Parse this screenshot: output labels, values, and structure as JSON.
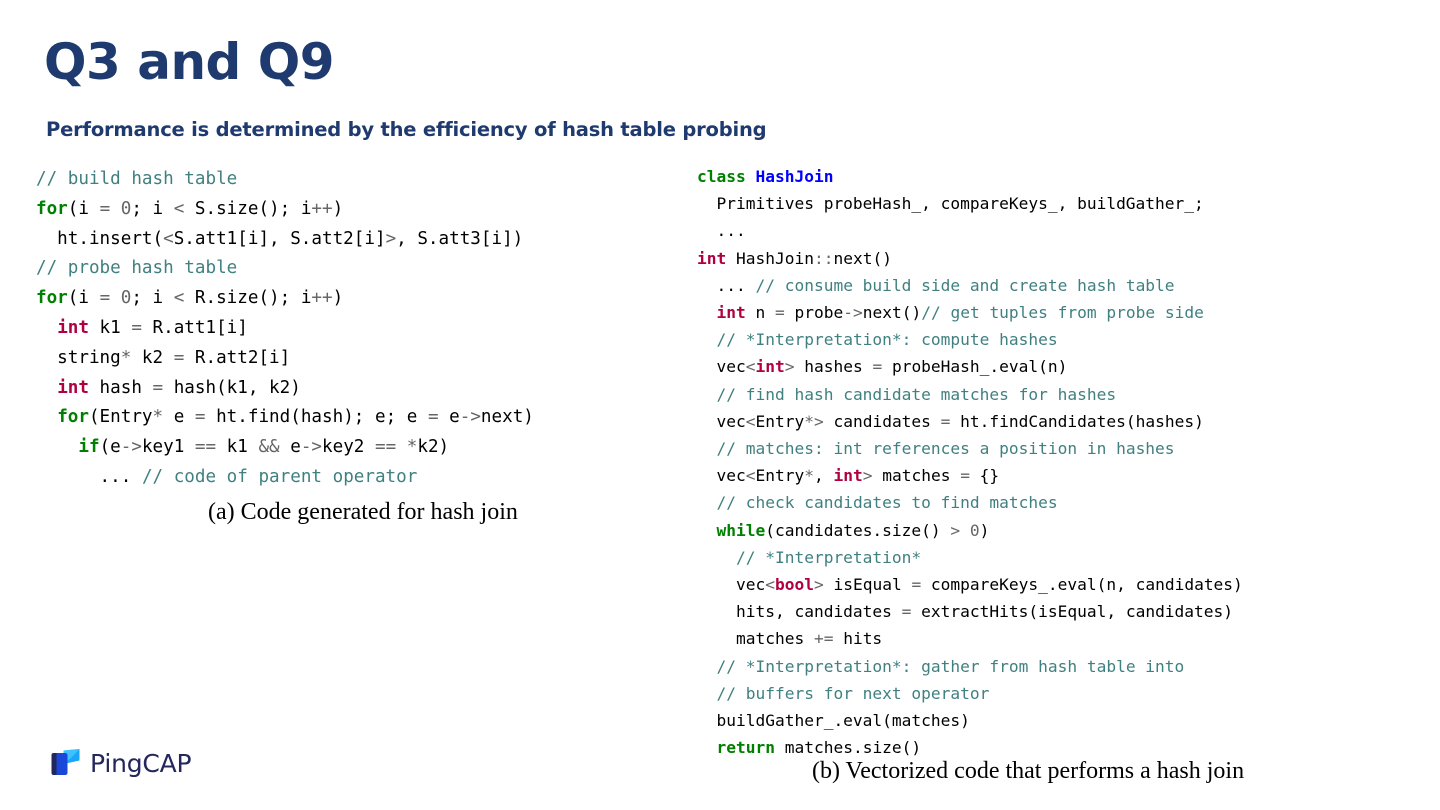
{
  "header": {
    "title": "Q3 and Q9",
    "subtitle": "Performance is determined by the efficiency of hash table probing",
    "title_color": "#1F3A6E"
  },
  "colors": {
    "comment": "#408080",
    "keyword": "#008000",
    "type": "#B00040",
    "class_name": "#0000FF",
    "operator": "#666666",
    "text": "#000000",
    "logo_dark": "#23275B",
    "logo_blue": "#1A9BF0"
  },
  "code_left": {
    "language": "cpp",
    "lines": [
      [
        {
          "t": "// build hash table",
          "c": "cmt"
        }
      ],
      [
        {
          "t": "for",
          "c": "kw"
        },
        {
          "t": "(i ",
          "c": "txt"
        },
        {
          "t": "=",
          "c": "op"
        },
        {
          "t": " ",
          "c": "txt"
        },
        {
          "t": "0",
          "c": "num"
        },
        {
          "t": "; i ",
          "c": "txt"
        },
        {
          "t": "<",
          "c": "op"
        },
        {
          "t": " S.size(); i",
          "c": "txt"
        },
        {
          "t": "++",
          "c": "op"
        },
        {
          "t": ")",
          "c": "txt"
        }
      ],
      [
        {
          "t": "  ht.insert(",
          "c": "txt"
        },
        {
          "t": "<",
          "c": "op"
        },
        {
          "t": "S.att1[i], S.att2[i]",
          "c": "txt"
        },
        {
          "t": ">",
          "c": "op"
        },
        {
          "t": ", S.att3[i])",
          "c": "txt"
        }
      ],
      [
        {
          "t": "// probe hash table",
          "c": "cmt"
        }
      ],
      [
        {
          "t": "for",
          "c": "kw"
        },
        {
          "t": "(i ",
          "c": "txt"
        },
        {
          "t": "=",
          "c": "op"
        },
        {
          "t": " ",
          "c": "txt"
        },
        {
          "t": "0",
          "c": "num"
        },
        {
          "t": "; i ",
          "c": "txt"
        },
        {
          "t": "<",
          "c": "op"
        },
        {
          "t": " R.size(); i",
          "c": "txt"
        },
        {
          "t": "++",
          "c": "op"
        },
        {
          "t": ")",
          "c": "txt"
        }
      ],
      [
        {
          "t": "  ",
          "c": "txt"
        },
        {
          "t": "int",
          "c": "type"
        },
        {
          "t": " k1 ",
          "c": "txt"
        },
        {
          "t": "=",
          "c": "op"
        },
        {
          "t": " R.att1[i]",
          "c": "txt"
        }
      ],
      [
        {
          "t": "  string",
          "c": "txt"
        },
        {
          "t": "*",
          "c": "op"
        },
        {
          "t": " k2 ",
          "c": "txt"
        },
        {
          "t": "=",
          "c": "op"
        },
        {
          "t": " R.att2[i]",
          "c": "txt"
        }
      ],
      [
        {
          "t": "  ",
          "c": "txt"
        },
        {
          "t": "int",
          "c": "type"
        },
        {
          "t": " hash ",
          "c": "txt"
        },
        {
          "t": "=",
          "c": "op"
        },
        {
          "t": " hash(k1, k2)",
          "c": "txt"
        }
      ],
      [
        {
          "t": "  ",
          "c": "txt"
        },
        {
          "t": "for",
          "c": "kw"
        },
        {
          "t": "(Entry",
          "c": "txt"
        },
        {
          "t": "*",
          "c": "op"
        },
        {
          "t": " e ",
          "c": "txt"
        },
        {
          "t": "=",
          "c": "op"
        },
        {
          "t": " ht.find(hash); e; e ",
          "c": "txt"
        },
        {
          "t": "=",
          "c": "op"
        },
        {
          "t": " e",
          "c": "txt"
        },
        {
          "t": "->",
          "c": "op"
        },
        {
          "t": "next)",
          "c": "txt"
        }
      ],
      [
        {
          "t": "    ",
          "c": "txt"
        },
        {
          "t": "if",
          "c": "kw"
        },
        {
          "t": "(e",
          "c": "txt"
        },
        {
          "t": "->",
          "c": "op"
        },
        {
          "t": "key1 ",
          "c": "txt"
        },
        {
          "t": "==",
          "c": "op"
        },
        {
          "t": " k1 ",
          "c": "txt"
        },
        {
          "t": "&&",
          "c": "op"
        },
        {
          "t": " e",
          "c": "txt"
        },
        {
          "t": "->",
          "c": "op"
        },
        {
          "t": "key2 ",
          "c": "txt"
        },
        {
          "t": "==",
          "c": "op"
        },
        {
          "t": " ",
          "c": "txt"
        },
        {
          "t": "*",
          "c": "op"
        },
        {
          "t": "k2)",
          "c": "txt"
        }
      ],
      [
        {
          "t": "      ... ",
          "c": "txt"
        },
        {
          "t": "// code of parent operator",
          "c": "cmt"
        }
      ]
    ]
  },
  "code_right": {
    "language": "cpp",
    "lines": [
      [
        {
          "t": "class",
          "c": "kw"
        },
        {
          "t": " ",
          "c": "txt"
        },
        {
          "t": "HashJoin",
          "c": "cls"
        }
      ],
      [
        {
          "t": "  Primitives probeHash_, compareKeys_, buildGather_;",
          "c": "txt"
        }
      ],
      [
        {
          "t": "  ...",
          "c": "txt"
        }
      ],
      [
        {
          "t": "int",
          "c": "type"
        },
        {
          "t": " HashJoin",
          "c": "txt"
        },
        {
          "t": "::",
          "c": "op"
        },
        {
          "t": "next()",
          "c": "txt"
        }
      ],
      [
        {
          "t": "  ... ",
          "c": "txt"
        },
        {
          "t": "// consume build side and create hash table",
          "c": "cmt"
        }
      ],
      [
        {
          "t": "  ",
          "c": "txt"
        },
        {
          "t": "int",
          "c": "type"
        },
        {
          "t": " n ",
          "c": "txt"
        },
        {
          "t": "=",
          "c": "op"
        },
        {
          "t": " probe",
          "c": "txt"
        },
        {
          "t": "->",
          "c": "op"
        },
        {
          "t": "next()",
          "c": "txt"
        },
        {
          "t": "// get tuples from probe side",
          "c": "cmt"
        }
      ],
      [
        {
          "t": "  ",
          "c": "txt"
        },
        {
          "t": "// *Interpretation*: compute hashes",
          "c": "cmt"
        }
      ],
      [
        {
          "t": "  vec",
          "c": "txt"
        },
        {
          "t": "<",
          "c": "op"
        },
        {
          "t": "int",
          "c": "type"
        },
        {
          "t": ">",
          "c": "op"
        },
        {
          "t": " hashes ",
          "c": "txt"
        },
        {
          "t": "=",
          "c": "op"
        },
        {
          "t": " probeHash_.eval(n)",
          "c": "txt"
        }
      ],
      [
        {
          "t": "  ",
          "c": "txt"
        },
        {
          "t": "// find hash candidate matches for hashes",
          "c": "cmt"
        }
      ],
      [
        {
          "t": "  vec",
          "c": "txt"
        },
        {
          "t": "<",
          "c": "op"
        },
        {
          "t": "Entry",
          "c": "txt"
        },
        {
          "t": "*>",
          "c": "op"
        },
        {
          "t": " candidates ",
          "c": "txt"
        },
        {
          "t": "=",
          "c": "op"
        },
        {
          "t": " ht.findCandidates(hashes)",
          "c": "txt"
        }
      ],
      [
        {
          "t": "  ",
          "c": "txt"
        },
        {
          "t": "// matches: int references a position in hashes",
          "c": "cmt"
        }
      ],
      [
        {
          "t": "  vec",
          "c": "txt"
        },
        {
          "t": "<",
          "c": "op"
        },
        {
          "t": "Entry",
          "c": "txt"
        },
        {
          "t": "*",
          "c": "op"
        },
        {
          "t": ", ",
          "c": "txt"
        },
        {
          "t": "int",
          "c": "type"
        },
        {
          "t": ">",
          "c": "op"
        },
        {
          "t": " matches ",
          "c": "txt"
        },
        {
          "t": "=",
          "c": "op"
        },
        {
          "t": " {}",
          "c": "txt"
        }
      ],
      [
        {
          "t": "  ",
          "c": "txt"
        },
        {
          "t": "// check candidates to find matches",
          "c": "cmt"
        }
      ],
      [
        {
          "t": "  ",
          "c": "txt"
        },
        {
          "t": "while",
          "c": "kw"
        },
        {
          "t": "(candidates.size() ",
          "c": "txt"
        },
        {
          "t": ">",
          "c": "op"
        },
        {
          "t": " ",
          "c": "txt"
        },
        {
          "t": "0",
          "c": "num"
        },
        {
          "t": ")",
          "c": "txt"
        }
      ],
      [
        {
          "t": "    ",
          "c": "txt"
        },
        {
          "t": "// *Interpretation*",
          "c": "cmt"
        }
      ],
      [
        {
          "t": "    vec",
          "c": "txt"
        },
        {
          "t": "<",
          "c": "op"
        },
        {
          "t": "bool",
          "c": "type"
        },
        {
          "t": ">",
          "c": "op"
        },
        {
          "t": " isEqual ",
          "c": "txt"
        },
        {
          "t": "=",
          "c": "op"
        },
        {
          "t": " compareKeys_.eval(n, candidates)",
          "c": "txt"
        }
      ],
      [
        {
          "t": "    hits, candidates ",
          "c": "txt"
        },
        {
          "t": "=",
          "c": "op"
        },
        {
          "t": " extractHits(isEqual, candidates)",
          "c": "txt"
        }
      ],
      [
        {
          "t": "    matches ",
          "c": "txt"
        },
        {
          "t": "+=",
          "c": "op"
        },
        {
          "t": " hits",
          "c": "txt"
        }
      ],
      [
        {
          "t": "  ",
          "c": "txt"
        },
        {
          "t": "// *Interpretation*: gather from hash table into",
          "c": "cmt"
        }
      ],
      [
        {
          "t": "  ",
          "c": "txt"
        },
        {
          "t": "// buffers for next operator",
          "c": "cmt"
        }
      ],
      [
        {
          "t": "  buildGather_.eval(matches)",
          "c": "txt"
        }
      ],
      [
        {
          "t": "  ",
          "c": "txt"
        },
        {
          "t": "return",
          "c": "kw"
        },
        {
          "t": " matches.size()",
          "c": "txt"
        }
      ]
    ]
  },
  "captions": {
    "a": "(a) Code generated for hash join",
    "b": "(b) Vectorized code that performs a hash join"
  },
  "footer": {
    "logo_text": "PingCAP"
  }
}
